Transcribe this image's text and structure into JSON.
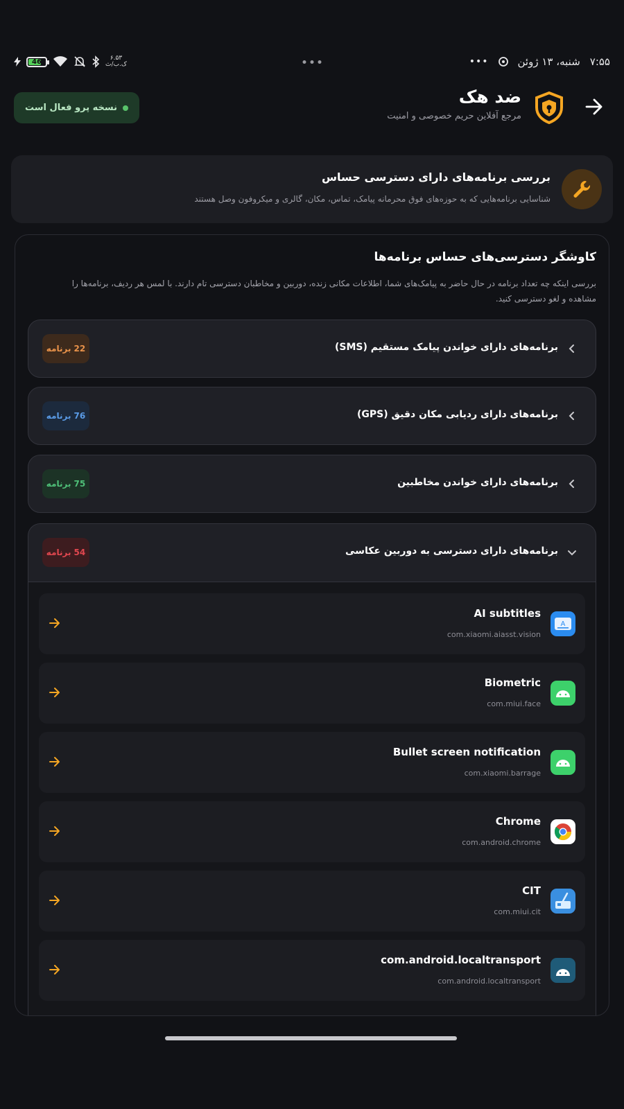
{
  "status_bar": {
    "time": "۷:۵۵",
    "date": "شنبه، ۱۳ ژوئن",
    "network_speed_value": "۶.۵۳",
    "network_speed_unit": "ک.ب/ث",
    "battery": "46"
  },
  "header": {
    "title": "ضد هک",
    "subtitle": "مرجع آفلاین حریم خصوصی و امنیت",
    "pro_badge": "نسخه پرو فعال است"
  },
  "feature_card": {
    "title": "بررسی برنامه‌های دارای دسترسی حساس",
    "description": "شناسایی برنامه‌هایی که به حوزه‌های فوق محرمانه پیامک، تماس، مکان، گالری و میکروفون وصل هستند"
  },
  "explorer": {
    "title": "کاوشگر دسترسی‌های حساس برنامه‌ها",
    "description": "بررسی اینکه چه تعداد برنامه در حال حاضر به پیامک‌های شما، اطلاعات مکانی زنده، دوربین و مخاطبان دسترسی تام دارند. با لمس هر ردیف، برنامه‌ها را مشاهده و لغو دسترسی کنید.",
    "count_unit": "برنامه",
    "categories": [
      {
        "label": "برنامه‌های دارای خواندن پیامک مستقیم (SMS)",
        "count": "22",
        "badge_bg": "#3d2a1c",
        "badge_fg": "#e8924a"
      },
      {
        "label": "برنامه‌های دارای ردیابی مکان دقیق (GPS)",
        "count": "76",
        "badge_bg": "#1c2a3d",
        "badge_fg": "#5a9be6"
      },
      {
        "label": "برنامه‌های دارای خواندن مخاطبین",
        "count": "75",
        "badge_bg": "#1c3326",
        "badge_fg": "#4fbf78"
      }
    ],
    "expanded_category": {
      "label": "برنامه‌های دارای دسترسی به دوربین عکاسی",
      "count": "54",
      "badge_bg": "#3d1c1f",
      "badge_fg": "#e0474f",
      "apps": [
        {
          "name": "AI subtitles",
          "package": "com.xiaomi.aiasst.vision",
          "icon": "subtitles-app-icon"
        },
        {
          "name": "Biometric",
          "package": "com.miui.face",
          "icon": "android-robot-icon"
        },
        {
          "name": "Bullet screen notification",
          "package": "com.xiaomi.barrage",
          "icon": "android-robot-icon"
        },
        {
          "name": "Chrome",
          "package": "com.android.chrome",
          "icon": "chrome-icon"
        },
        {
          "name": "CIT",
          "package": "com.miui.cit",
          "icon": "cit-tool-icon"
        },
        {
          "name": "com.android.localtransport",
          "package": "com.android.localtransport",
          "icon": "android-robot-dark-icon"
        }
      ]
    }
  },
  "colors": {
    "accent_orange": "#f5a623",
    "background": "#111216",
    "card": "#1d1e23"
  }
}
